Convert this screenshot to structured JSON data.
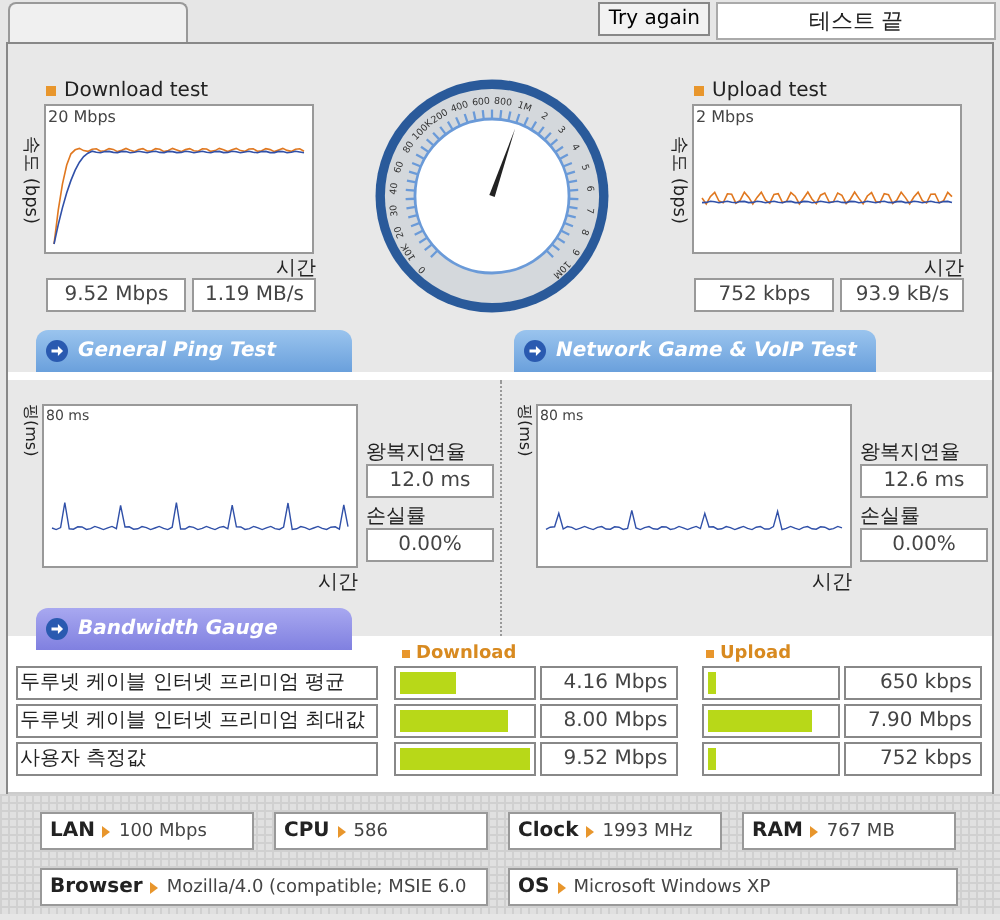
{
  "header": {
    "try_again": "Try again",
    "status": "테스트 끝"
  },
  "download": {
    "title": "Download test",
    "y_axis": "속도 (bps)",
    "scale": "20 Mbps",
    "x_axis": "시간",
    "rate": "9.52 Mbps",
    "bytes": "1.19 MB/s"
  },
  "gauge": {
    "dial_labels": [
      "0",
      "10K",
      "20",
      "30",
      "40",
      "60",
      "80",
      "100K",
      "200",
      "400",
      "600",
      "800",
      "1M",
      "2",
      "3",
      "4",
      "5",
      "6",
      "7",
      "8",
      "9",
      "10M"
    ]
  },
  "upload": {
    "title": "Upload test",
    "y_axis": "속도 (bps)",
    "scale": "2 Mbps",
    "x_axis": "시간",
    "rate": "752 kbps",
    "bytes": "93.9 kB/s"
  },
  "section_tabs": [
    "General Ping Test",
    "Network Game & VoIP Test"
  ],
  "ping_panels": [
    {
      "y_axis": "핑(ms)",
      "scale": "80 ms",
      "x_axis": "시간",
      "latency_label": "왕복지연율",
      "latency": "12.0 ms",
      "loss_label": "손실률",
      "loss": "0.00%"
    },
    {
      "y_axis": "핑(ms)",
      "scale": "80 ms",
      "x_axis": "시간",
      "latency_label": "왕복지연율",
      "latency": "12.6 ms",
      "loss_label": "손실률",
      "loss": "0.00%"
    }
  ],
  "bandwidth": {
    "tab": "Bandwidth Gauge",
    "download_header": "Download",
    "upload_header": "Upload",
    "rows": [
      {
        "label": "두루넷 케이블 인터넷 프리미엄 평균",
        "download": {
          "level": 0.43,
          "value": "4.16 Mbps"
        },
        "upload": {
          "level": 0.06,
          "value": "650 kbps"
        }
      },
      {
        "label": "두루넷 케이블 인터넷 프리미엄 최대값",
        "download": {
          "level": 0.84,
          "value": "8.00 Mbps"
        },
        "upload": {
          "level": 0.83,
          "value": "7.90 Mbps"
        }
      },
      {
        "label": "사용자 측정값",
        "download": {
          "level": 1.0,
          "value": "9.52 Mbps"
        },
        "upload": {
          "level": 0.07,
          "value": "752 kbps"
        }
      }
    ]
  },
  "system_info": [
    {
      "label": "LAN",
      "value": "100 Mbps"
    },
    {
      "label": "CPU",
      "value": "586"
    },
    {
      "label": "Clock",
      "value": "1993 MHz"
    },
    {
      "label": "RAM",
      "value": "767 MB"
    },
    {
      "label": "Browser",
      "value": "Mozilla/4.0 (compatible; MSIE 6.0"
    },
    {
      "label": "OS",
      "value": "Microsoft Windows XP"
    }
  ]
}
